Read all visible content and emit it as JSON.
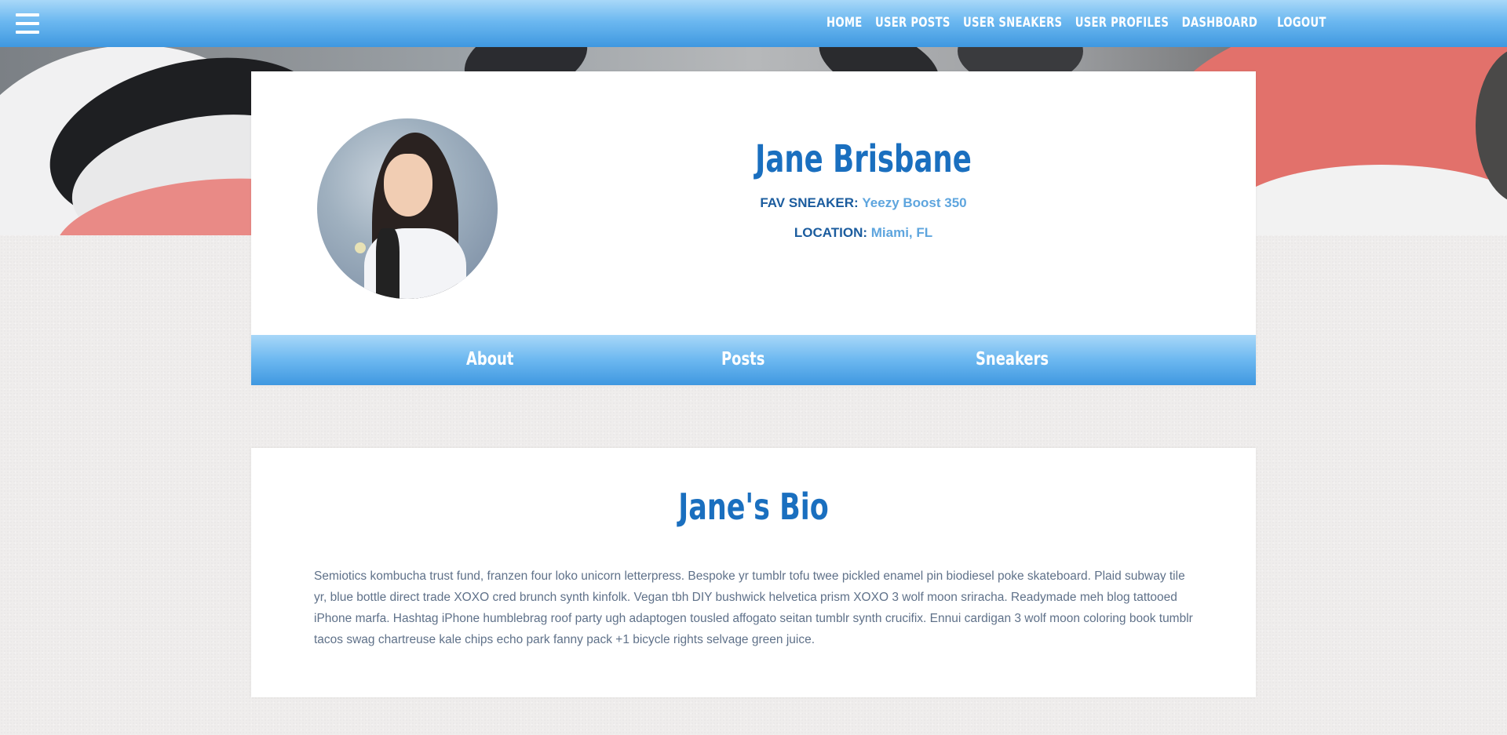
{
  "nav": {
    "menu_icon": "hamburger-menu-icon",
    "links": [
      "HOME",
      "USER POSTS",
      "USER SNEAKERS",
      "USER PROFILES",
      "DASHBOARD",
      "LOGOUT"
    ]
  },
  "profile": {
    "name": "Jane Brisbane",
    "fav_sneaker_label": "FAV SNEAKER:",
    "fav_sneaker": "Yeezy Boost 350",
    "location_label": "LOCATION:",
    "location": "Miami, FL"
  },
  "tabs": [
    "About",
    "Posts",
    "Sneakers"
  ],
  "bio": {
    "title": "Jane's Bio",
    "text": "Semiotics kombucha trust fund, franzen four loko unicorn letterpress. Bespoke yr tumblr tofu twee pickled enamel pin biodiesel poke skateboard. Plaid subway tile yr, blue bottle direct trade XOXO cred brunch synth kinfolk. Vegan tbh DIY bushwick helvetica prism XOXO 3 wolf moon sriracha. Readymade meh blog tattooed iPhone marfa. Hashtag iPhone humblebrag roof party ugh adaptogen tousled affogato seitan tumblr synth crucifix. Ennui cardigan 3 wolf moon coloring book tumblr tacos swag chartreuse kale chips echo park fanny pack +1 bicycle rights selvage green juice."
  },
  "colors": {
    "nav_gradient_top": "#a8d8f8",
    "nav_gradient_bottom": "#3f98e0",
    "heading_blue": "#1a6fbf",
    "label_blue": "#1b5c9e",
    "value_blue": "#5ea5de",
    "body_text": "#5f7189",
    "page_bg": "#efedec"
  }
}
